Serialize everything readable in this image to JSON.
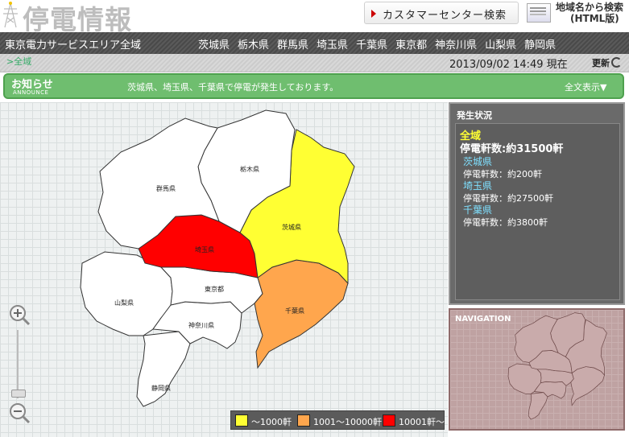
{
  "header": {
    "logo_text": "停電情報",
    "customer_center_label": "カスタマーセンター検索",
    "area_search_line1": "地域名から検索",
    "area_search_line2": "(HTML版)"
  },
  "navbar": {
    "all_area": "東京電力サービスエリア全域",
    "prefectures": [
      "茨城県",
      "栃木県",
      "群馬県",
      "埼玉県",
      "千葉県",
      "東京都",
      "神奈川県",
      "山梨県",
      "静岡県"
    ]
  },
  "subbar": {
    "breadcrumb": ">全域",
    "datetime": "2013/09/02 14:49 現在",
    "refresh_label": "更新"
  },
  "announce": {
    "title": "お知らせ",
    "subtitle": "ANNOUNCE",
    "message": "茨城県、埼玉県、千葉県で停電が発生しております。",
    "full_text_label": "全文表示▼"
  },
  "map": {
    "labels": {
      "gunma": "群馬県",
      "tochigi": "栃木県",
      "ibaraki": "茨城県",
      "saitama": "埼玉県",
      "tokyo": "東京都",
      "chiba": "千葉県",
      "yamanashi": "山梨県",
      "kanagawa": "神奈川県",
      "shizuoka": "静岡県"
    },
    "colors": {
      "low": "#ffff33",
      "mid": "#ffa64d",
      "high": "#ff0000",
      "none": "#ffffff"
    }
  },
  "legend": {
    "items": [
      {
        "label": "〜1000軒",
        "color": "#ffff33"
      },
      {
        "label": "1001〜10000軒",
        "color": "#ffa64d"
      },
      {
        "label": "10001軒〜",
        "color": "#ff0000"
      }
    ]
  },
  "status": {
    "heading": "発生状況",
    "all_label": "全域",
    "all_count": "停電軒数:約31500軒",
    "regions": [
      {
        "name": "茨城県",
        "count": "停電軒数：約200軒"
      },
      {
        "name": "埼玉県",
        "count": "停電軒数：約27500軒"
      },
      {
        "name": "千葉県",
        "count": "停電軒数：約3800軒"
      }
    ]
  },
  "navigation": {
    "heading": "NAVIGATION"
  }
}
